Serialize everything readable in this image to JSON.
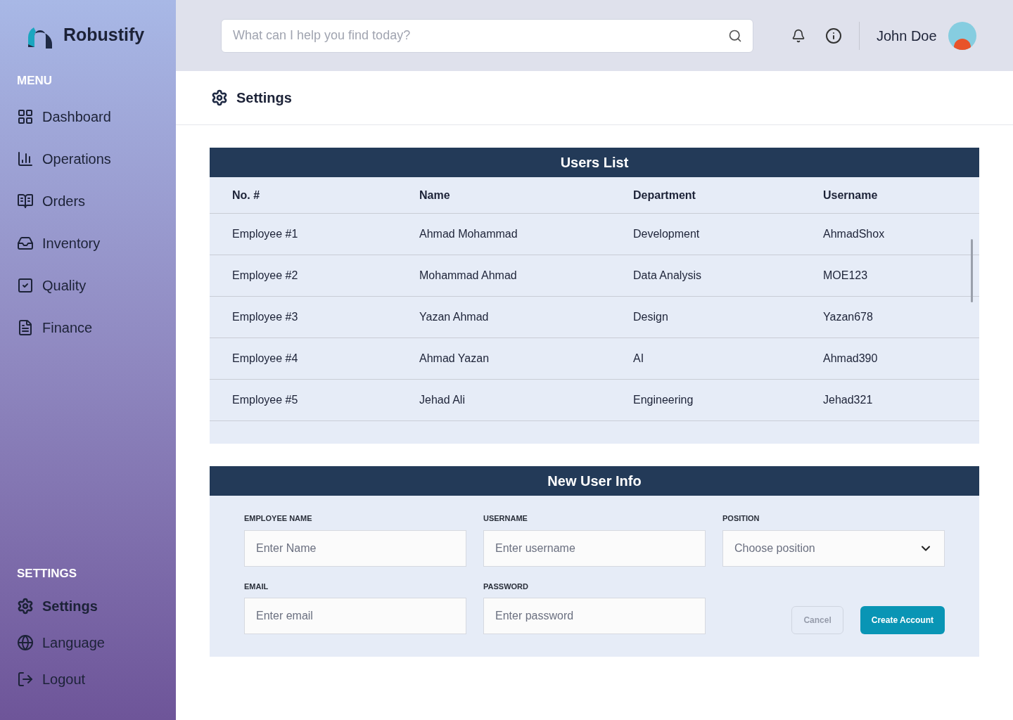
{
  "brand": "Robustify",
  "sidebar": {
    "menu_heading": "MENU",
    "menu_items": [
      {
        "kind": "dashboard",
        "label": "Dashboard",
        "selected": false
      },
      {
        "kind": "operations",
        "label": "Operations",
        "selected": false
      },
      {
        "kind": "orders",
        "label": "Orders",
        "selected": false
      },
      {
        "kind": "inventory",
        "label": "Inventory",
        "selected": false
      },
      {
        "kind": "quality",
        "label": "Quality",
        "selected": false
      },
      {
        "kind": "finance",
        "label": "Finance",
        "selected": false
      }
    ],
    "settings_heading": "SETTINGS",
    "settings_items": [
      {
        "kind": "settings",
        "label": "Settings",
        "selected": true
      },
      {
        "kind": "language",
        "label": "Language",
        "selected": false
      },
      {
        "kind": "logout",
        "label": "Logout",
        "selected": false
      }
    ]
  },
  "topbar": {
    "search": {
      "placeholder": "What can I help you find today?"
    },
    "user_name": "John Doe"
  },
  "page_title": "Settings",
  "users_table": {
    "title": "Users List",
    "columns": [
      "No. #",
      "Name",
      "Department",
      "Username"
    ],
    "rows": [
      [
        "Employee #1",
        "Ahmad Mohammad",
        "Development",
        "AhmadShox"
      ],
      [
        "Employee #2",
        "Mohammad Ahmad",
        "Data Analysis",
        "MOE123"
      ],
      [
        "Employee #3",
        "Yazan Ahmad",
        "Design",
        "Yazan678"
      ],
      [
        "Employee #4",
        "Ahmad Yazan",
        "AI",
        "Ahmad390"
      ],
      [
        "Employee #5",
        "Jehad Ali",
        "Engineering",
        "Jehad321"
      ]
    ]
  },
  "new_user_form": {
    "title": "New User Info",
    "fields": [
      {
        "kind": "text",
        "label": "EMPLOYEE NAME",
        "placeholder": "Enter Name"
      },
      {
        "kind": "text",
        "label": "USERNAME",
        "placeholder": "Enter username"
      },
      {
        "kind": "select",
        "label": "POSITION",
        "placeholder": "Choose position"
      },
      {
        "kind": "text",
        "label": "EMAIL",
        "placeholder": "Enter email"
      },
      {
        "kind": "password",
        "label": "PASSWORD",
        "placeholder": "Enter password"
      }
    ],
    "buttons": [
      {
        "kind": "secondary",
        "label": "Cancel",
        "disabled": true
      },
      {
        "kind": "primary",
        "label": "Create Account",
        "disabled": false
      }
    ]
  }
}
